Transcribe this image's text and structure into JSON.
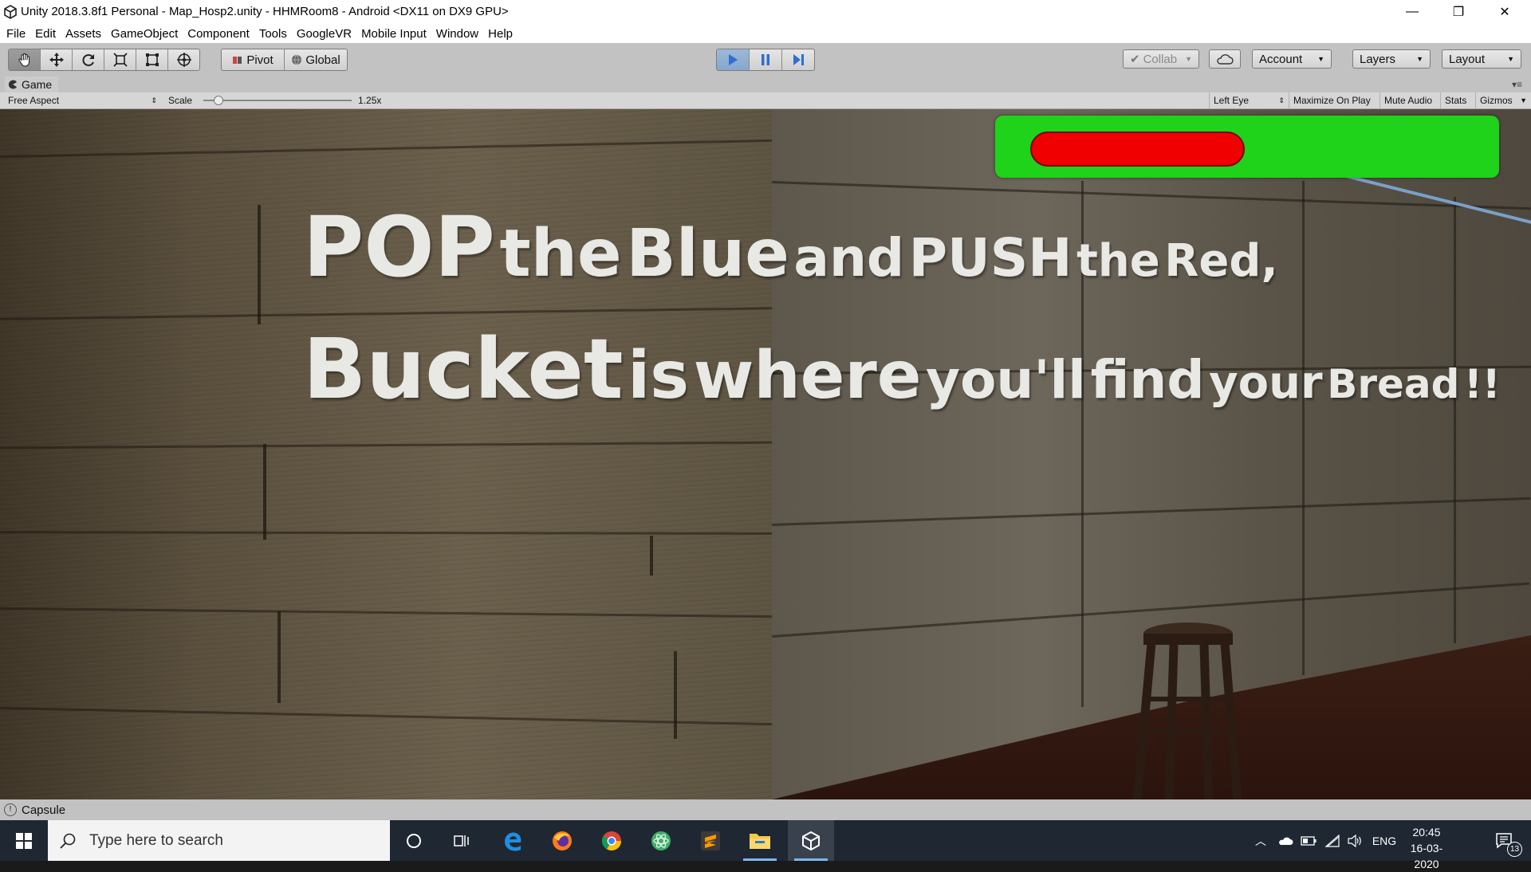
{
  "window": {
    "title": "Unity 2018.3.8f1 Personal - Map_Hosp2.unity - HHMRoom8 - Android <DX11 on DX9 GPU>",
    "controls": {
      "minimize": "—",
      "maximize": "❐",
      "close": "✕"
    }
  },
  "menu": [
    "File",
    "Edit",
    "Assets",
    "GameObject",
    "Component",
    "Tools",
    "GoogleVR",
    "Mobile Input",
    "Window",
    "Help"
  ],
  "toolbar": {
    "pivot_label": "Pivot",
    "global_label": "Global",
    "collab_label": "Collab",
    "account_label": "Account",
    "layers_label": "Layers",
    "layout_label": "Layout",
    "colors": {
      "play_active": "#3a78d4"
    }
  },
  "game_panel": {
    "tab_label": "Game",
    "aspect": "Free Aspect",
    "scale_label": "Scale",
    "scale_value": "1.25x",
    "scale_slider_fraction": 0.1,
    "eye": "Left Eye",
    "maximize_on_play": "Maximize On Play",
    "mute_audio": "Mute Audio",
    "stats": "Stats",
    "gizmos": "Gizmos"
  },
  "scene": {
    "wall_text": {
      "line1": [
        "POP",
        "the",
        "Blue",
        "and",
        "PUSH",
        "the",
        "Red,"
      ],
      "line2": [
        "Bucket",
        "is",
        "where",
        "you'll",
        "find",
        "your",
        "Bread",
        "!!"
      ]
    },
    "health_fraction": 0.45,
    "colors": {
      "bar_bg": "#1fd21a",
      "bar_fill": "#f00000"
    }
  },
  "status": {
    "selection": "Capsule"
  },
  "taskbar": {
    "search_placeholder": "Type here to search",
    "lang": "ENG",
    "time": "20:45",
    "date": "16-03-2020",
    "notification_count": "13"
  }
}
